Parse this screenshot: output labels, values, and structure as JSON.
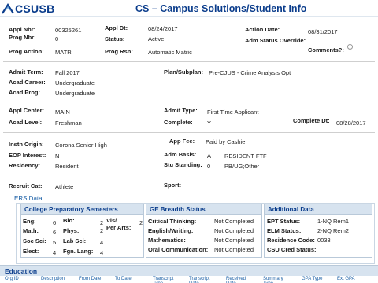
{
  "header": {
    "logo_text": "CSUSB",
    "title": "CS – Campus Solutions/Student Info"
  },
  "appl": {
    "appl_nbr_label": "Appl Nbr:",
    "appl_nbr": "00325261",
    "appl_dt_label": "Appl Dt:",
    "appl_dt": "08/24/2017",
    "action_date_label": "Action Date:",
    "action_date": "08/31/2017",
    "prog_nbr_label": "Prog Nbr:",
    "prog_nbr": "0",
    "status_label": "Status:",
    "status": "Active",
    "adm_status_override_label": "Adm Status Override:",
    "prog_action_label": "Prog Action:",
    "prog_action": "MATR",
    "prog_rsn_label": "Prog Rsn:",
    "prog_rsn": "Automatic Matric",
    "comments_label": "Comments?:"
  },
  "term": {
    "admit_term_label": "Admit Term:",
    "admit_term": "Fall 2017",
    "plan_subplan_label": "Plan/Subplan:",
    "plan_subplan": "Pre-CJUS - Crime Analysis Opt",
    "acad_career_label": "Acad Career:",
    "acad_career": "Undergraduate",
    "acad_prog_label": "Acad Prog:",
    "acad_prog": "Undergraduate"
  },
  "center": {
    "appl_center_label": "Appl Center:",
    "appl_center": "MAIN",
    "admit_type_label": "Admit Type:",
    "admit_type": "First Time Applicant",
    "acad_level_label": "Acad Level:",
    "acad_level": "Freshman",
    "complete_label": "Complete:",
    "complete": "Y",
    "complete_dt_label": "Complete Dt:",
    "complete_dt": "08/28/2017"
  },
  "origin": {
    "instn_origin_label": "Instn Origin:",
    "instn_origin": "Corona Senior High",
    "app_fee_label": "App Fee:",
    "app_fee": "Paid by Cashier",
    "eop_interest_label": "EOP Interest:",
    "eop_interest": "N",
    "adm_basis_label": "Adm Basis:",
    "adm_basis_code": "A",
    "adm_basis": "RESIDENT FTF",
    "residency_label": "Residency:",
    "residency": "Resident",
    "stu_standing_label": "Stu Standing:",
    "stu_standing_code": "0",
    "stu_standing": "PB/UG;Other"
  },
  "recruit": {
    "recruit_cat_label": "Recruit Cat:",
    "recruit_cat": "Athlete",
    "sport_label": "Sport:"
  },
  "ers": {
    "title": "ERS Data",
    "prep": {
      "title": "College Preparatory Semesters",
      "eng_label": "Eng:",
      "eng": "6",
      "bio_label": "Bio:",
      "bio": "2",
      "vis_label": "Vis/",
      "vis_label2": "Per Arts:",
      "vis": "2",
      "math_label": "Math:",
      "math": "6",
      "phys_label": "Phys:",
      "phys": "2",
      "socsci_label": "Soc Sci:",
      "socsci": "5",
      "labsci_label": "Lab Sci:",
      "labsci": "4",
      "elect_label": "Elect:",
      "elect": "4",
      "fgn_label": "Fgn. Lang:",
      "fgn": "4"
    },
    "ge": {
      "title": "GE Breadth Status",
      "critical_label": "Critical Thinking:",
      "critical": "Not Completed",
      "english_label": "English/Writing:",
      "english": "Not Completed",
      "mathematics_label": "Mathematics:",
      "mathematics": "Not Completed",
      "oral_label": "Oral Communication:",
      "oral": "Not Completed"
    },
    "add": {
      "title": "Additional Data",
      "ept_label": "EPT Status:",
      "ept": "1-NQ Rem1",
      "elm_label": "ELM Status:",
      "elm": "2-NQ Rem2",
      "residence_label": "Residence Code:",
      "residence": "0033",
      "csu_cred_label": "CSU Cred Status:"
    }
  },
  "education": {
    "title": "Education",
    "columns": [
      "Org ID",
      "Description",
      "From Date",
      "To Date",
      "Transcript Type",
      "Transcript Date",
      "Received Date",
      "Summary Type",
      "GPA Type",
      "Ext GPA"
    ]
  }
}
